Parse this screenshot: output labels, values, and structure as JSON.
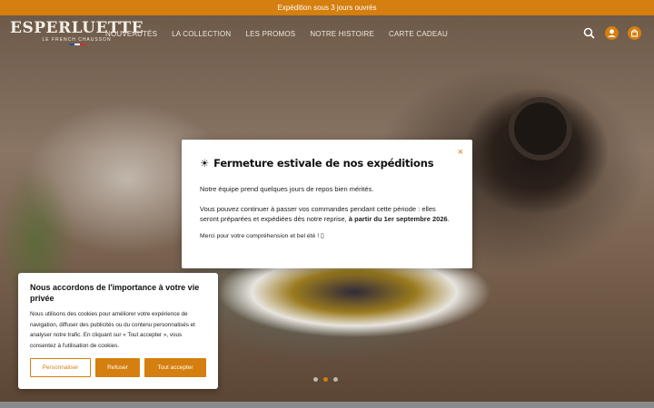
{
  "announcement": "Expédition sous 3 jours ouvrés",
  "brand": {
    "name": "ESPERLUETTE",
    "tagline": "LE FRENCH CHAUSSON"
  },
  "nav": [
    "NOUVEAUTÉS",
    "LA COLLECTION",
    "LES PROMOS",
    "NOTRE HISTOIRE",
    "CARTE CADEAU"
  ],
  "header_icons": [
    "search-icon",
    "user-icon",
    "cart-icon"
  ],
  "modal": {
    "icon": "☀",
    "title": "Fermeture estivale de nos expéditions",
    "close": "×",
    "p1": "Notre équipe prend quelques jours de repos bien mérités.",
    "p2": "Vous pouvez continuer à passer vos commandes pendant cette période : elles seront préparées et expédiées dès notre reprise, ",
    "p2_bold": "à partir du 1er septembre 2026",
    "p2_end": ".",
    "p3": "Merci pour votre compréhension et bel été ! ▯"
  },
  "cookie": {
    "title": "Nous accordons de l'importance à votre vie privée",
    "text": "Nous utilisons des cookies pour améliorer votre expérience de navigation, diffuser des publicités ou du contenu personnalisés et analyser notre trafic. En cliquant sur « Tout accepter », vous consentez à l'utilisation de cookies.",
    "customize": "Personnaliser",
    "refuse": "Refuser",
    "accept": "Tout accepter"
  },
  "colors": {
    "accent": "#d47f0f"
  }
}
